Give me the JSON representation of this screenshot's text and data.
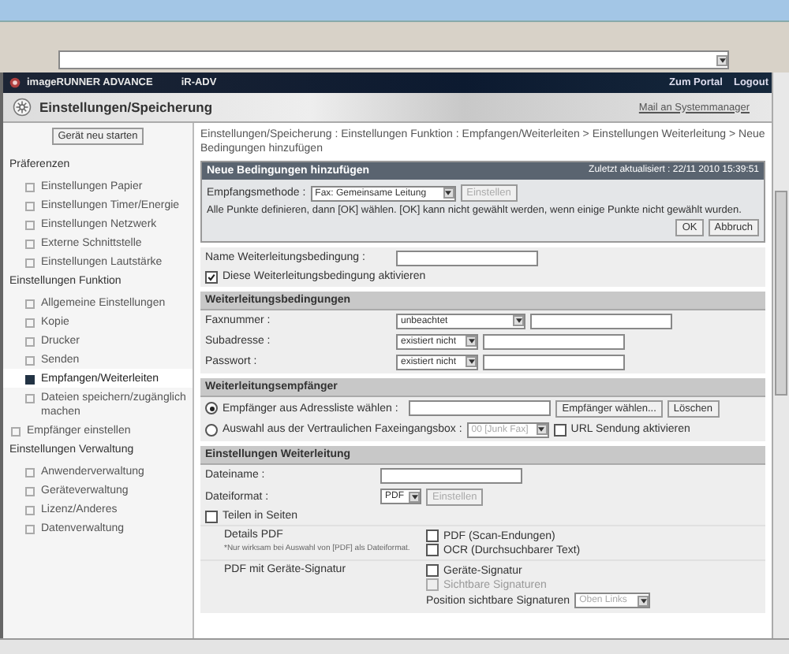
{
  "header": {
    "product": "imageRUNNER ADVANCE",
    "model": "iR-ADV",
    "links": [
      "Zum Portal",
      "Logout"
    ]
  },
  "page_title": "Einstellungen/Speicherung",
  "mail_link": "Mail an Systemmanager",
  "sidebar": {
    "restart_button": "Gerät neu starten",
    "sections": [
      {
        "kind": "group",
        "label": "Präferenzen",
        "children": [
          {
            "label": "Einstellungen Papier",
            "selected": false
          },
          {
            "label": "Einstellungen Timer/Energie",
            "selected": false
          },
          {
            "label": "Einstellungen Netzwerk",
            "selected": false
          },
          {
            "label": "Externe Schnittstelle",
            "selected": false
          },
          {
            "label": "Einstellungen Lautstärke",
            "selected": false
          }
        ]
      },
      {
        "kind": "group",
        "label": "Einstellungen Funktion",
        "children": [
          {
            "label": "Allgemeine Einstellungen",
            "selected": false
          },
          {
            "label": "Kopie",
            "selected": false
          },
          {
            "label": "Drucker",
            "selected": false
          },
          {
            "label": "Senden",
            "selected": false
          },
          {
            "label": "Empfangen/Weiterleiten",
            "selected": true
          },
          {
            "label": "Dateien speichern/zugänglich machen",
            "selected": false
          }
        ]
      },
      {
        "kind": "item",
        "label": "Empfänger einstellen",
        "selected": false
      },
      {
        "kind": "group",
        "label": "Einstellungen Verwaltung",
        "children": [
          {
            "label": "Anwenderverwaltung",
            "selected": false
          },
          {
            "label": "Geräteverwaltung",
            "selected": false
          },
          {
            "label": "Lizenz/Anderes",
            "selected": false
          },
          {
            "label": "Datenverwaltung",
            "selected": false
          }
        ]
      }
    ]
  },
  "breadcrumb": "Einstellungen/Speicherung : Einstellungen Funktion : Empfangen/Weiterleiten > Einstellungen Weiterleitung > Neue Bedingungen hinzufügen",
  "dialog": {
    "title": "Neue Bedingungen hinzufügen",
    "updated": "Zuletzt aktualisiert : 22/11 2010 15:39:51",
    "method_label": "Empfangsmethode :",
    "method_value": "Fax: Gemeinsame Leitung",
    "set_button": {
      "label": "Einstellen",
      "disabled": true
    },
    "note": "Alle Punkte definieren, dann [OK] wählen. [OK] kann nicht gewählt werden, wenn einige Punkte nicht gewählt wurden.",
    "buttons": [
      "OK",
      "Abbruch"
    ]
  },
  "name_label": "Name Weiterleitungsbedingung :",
  "enable_checkbox": {
    "label": "Diese Weiterleitungsbedingung aktivieren",
    "checked": true
  },
  "conditions": {
    "title": "Weiterleitungsbedingungen",
    "rows": [
      {
        "label": "Faxnummer :",
        "select": "unbeachtet"
      },
      {
        "label": "Subadresse :",
        "select": "existiert nicht"
      },
      {
        "label": "Passwort :",
        "select": "existiert nicht"
      }
    ]
  },
  "recipients": {
    "title": "Weiterleitungsempfänger",
    "options": [
      {
        "kind": "address",
        "label": "Empfänger aus Adressliste wählen :",
        "selected": true,
        "buttons": [
          "Empfänger wählen...",
          "Löschen"
        ]
      },
      {
        "kind": "box",
        "label": "Auswahl aus der Vertraulichen Faxeingangsbox :",
        "selected": false,
        "select": "00 [Junk Fax]",
        "checkbox": {
          "label": "URL Sendung aktivieren",
          "checked": false
        }
      }
    ]
  },
  "forwarding": {
    "title": "Einstellungen Weiterleitung",
    "file_name_label": "Dateiname :",
    "format_label": "Dateiformat :",
    "format_value": "PDF",
    "format_button": {
      "label": "Einstellen",
      "disabled": true
    },
    "split_checkbox": {
      "label": "Teilen in Seiten",
      "checked": false
    },
    "groups": [
      {
        "label": "Details PDF",
        "note": "*Nur wirksam bei Auswahl von [PDF] als Dateiformat.",
        "checkboxes": [
          {
            "label": "PDF (Scan-Endungen)",
            "checked": false,
            "disabled": false
          },
          {
            "label": "OCR (Durchsuchbarer Text)",
            "checked": false,
            "disabled": false
          }
        ]
      },
      {
        "label": "PDF mit Geräte-Signatur",
        "checkboxes": [
          {
            "label": "Geräte-Signatur",
            "checked": false,
            "disabled": false
          },
          {
            "label": "Sichtbare Signaturen",
            "checked": false,
            "disabled": true
          }
        ],
        "position_label": "Position sichtbare Signaturen",
        "position_value": "Oben Links"
      }
    ]
  }
}
